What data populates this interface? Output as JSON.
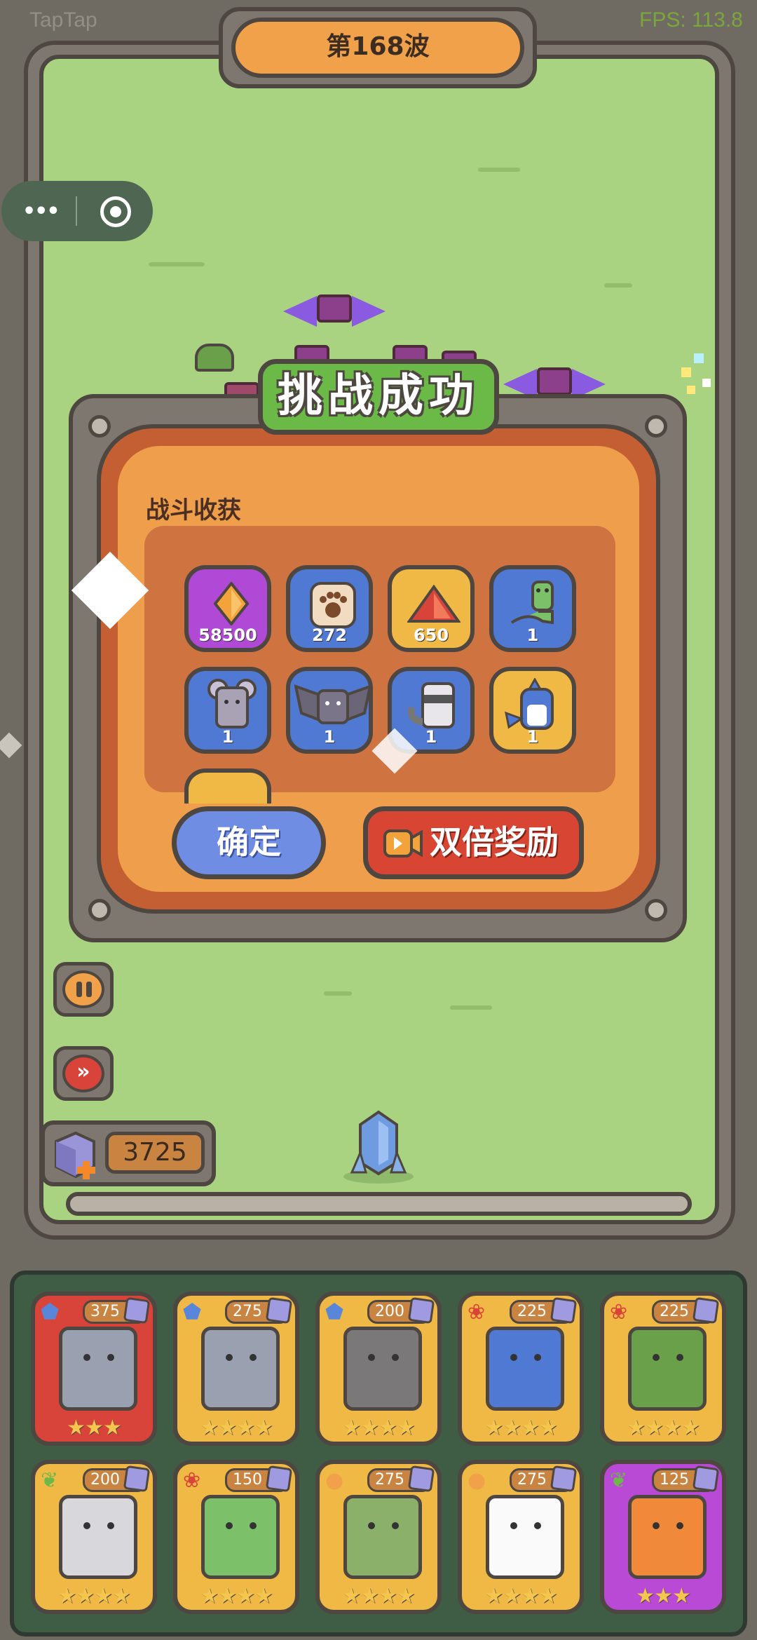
{
  "status_bar": {
    "app_name": "TapTap",
    "fps": "FPS: 113.8"
  },
  "wave": {
    "label": "第168波"
  },
  "dialog": {
    "title": "挑战成功",
    "loot_label": "战斗收获",
    "items": [
      {
        "icon": "orange-crystal-icon",
        "count": "58500",
        "color": "#b04ad6"
      },
      {
        "icon": "paw-scroll-icon",
        "count": "272",
        "color": "#4f79d2"
      },
      {
        "icon": "red-triangle-shard-icon",
        "count": "650",
        "color": "#f0b845"
      },
      {
        "icon": "snake-icon",
        "count": "1",
        "color": "#4f79d2"
      },
      {
        "icon": "mouse-icon",
        "count": "1",
        "color": "#4f79d2"
      },
      {
        "icon": "bat-icon",
        "count": "1",
        "color": "#4f79d2"
      },
      {
        "icon": "raccoon-icon",
        "count": "1",
        "color": "#4f79d2"
      },
      {
        "icon": "shark-icon",
        "count": "1",
        "color": "#f0b845"
      }
    ],
    "confirm_label": "确定",
    "double_label": "双倍奖励"
  },
  "resources": {
    "gems": "3725"
  },
  "deck": {
    "cards": [
      {
        "animal": "mammoth-dragon",
        "cost": "375",
        "type": "shield",
        "stars": "★★★",
        "bg": "#d9443a"
      },
      {
        "animal": "elephant",
        "cost": "275",
        "type": "shield",
        "stars": "★★★★",
        "bg": "#f0b845"
      },
      {
        "animal": "hippo",
        "cost": "200",
        "type": "shield",
        "stars": "★★★★",
        "bg": "#f0b845"
      },
      {
        "animal": "shark",
        "cost": "225",
        "type": "paw",
        "stars": "★★★★",
        "bg": "#f0b845"
      },
      {
        "animal": "frog",
        "cost": "225",
        "type": "paw",
        "stars": "★★★★",
        "bg": "#f0b845"
      },
      {
        "animal": "snow-leopard",
        "cost": "200",
        "type": "leaf",
        "stars": "★★★★",
        "bg": "#f0b845"
      },
      {
        "animal": "frog-head",
        "cost": "150",
        "type": "paw",
        "stars": "★★★★",
        "bg": "#f0b845"
      },
      {
        "animal": "dragon",
        "cost": "275",
        "type": "bubble",
        "stars": "★★★★",
        "bg": "#f0b845"
      },
      {
        "animal": "rabbit",
        "cost": "275",
        "type": "bubble",
        "stars": "★★★★",
        "bg": "#f0b845"
      },
      {
        "animal": "cat",
        "cost": "125",
        "type": "leaf",
        "stars": "★★★",
        "bg": "#b84ad6"
      }
    ]
  }
}
